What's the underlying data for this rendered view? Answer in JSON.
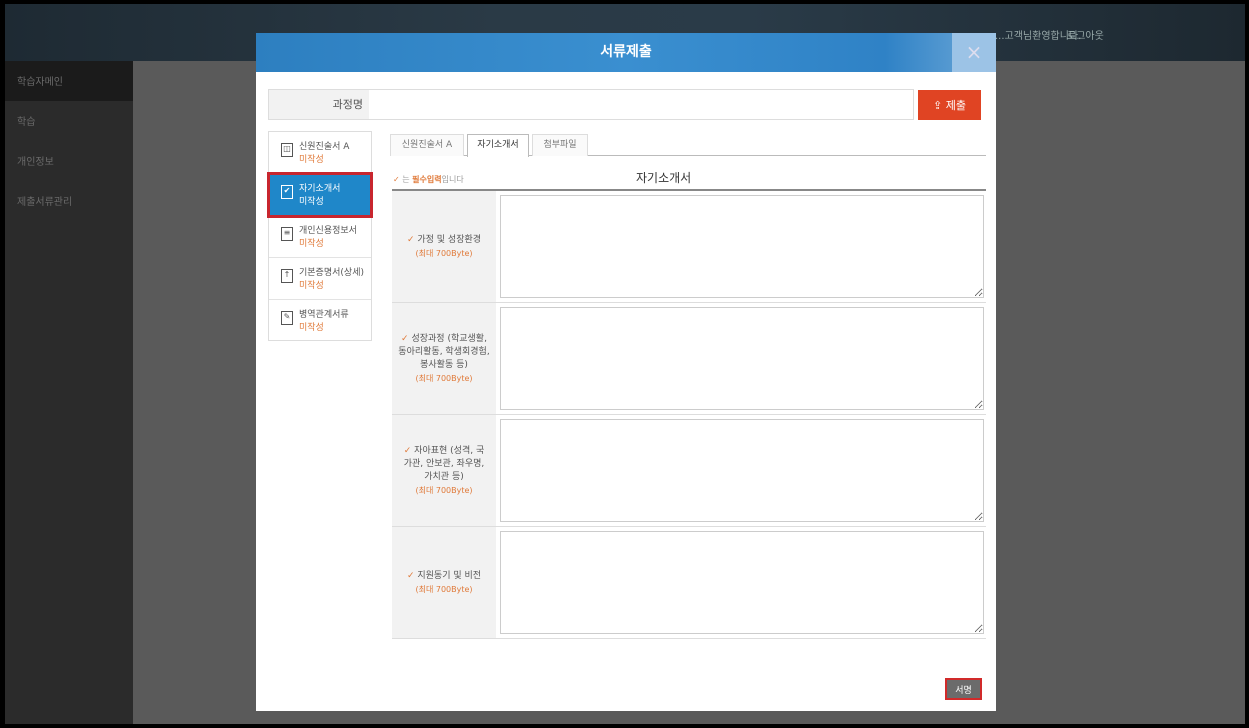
{
  "topbar": {
    "user_text": "...고객님환영합니다.",
    "logout_label": "로그아웃"
  },
  "leftnav": {
    "items": [
      {
        "label": "학습자메인"
      },
      {
        "label": "학습"
      },
      {
        "label": "개인정보"
      },
      {
        "label": "제출서류관리"
      }
    ]
  },
  "modal": {
    "title": "서류제출",
    "close_label": "×",
    "course_label": "과정명",
    "course_value": "",
    "submit_label": "⇪ 제출",
    "sign_label": "서명"
  },
  "documents": [
    {
      "name": "신원진술서 A",
      "status": "미작성",
      "icon": "document-icon",
      "glyph": "◫"
    },
    {
      "name": "자기소개서",
      "status": "미작성",
      "icon": "checkbox-icon",
      "glyph": "✔"
    },
    {
      "name": "개인신용정보서",
      "status": "미작성",
      "icon": "list-icon",
      "glyph": "≡"
    },
    {
      "name": "기본증명서(상세)",
      "status": "미작성",
      "icon": "upload-icon",
      "glyph": "↑"
    },
    {
      "name": "병역관계서류",
      "status": "미작성",
      "icon": "edit-icon",
      "glyph": "✎"
    }
  ],
  "tabs": [
    {
      "label": "신원진술서 A"
    },
    {
      "label": "자기소개서"
    },
    {
      "label": "첨부파일"
    }
  ],
  "required_note": {
    "mark": "✓",
    "prefix": " 는 ",
    "strong": "필수입력",
    "suffix": "입니다"
  },
  "section_title": "자기소개서",
  "form_rows": [
    {
      "check": "✓",
      "label": "가정 및 성장환경",
      "limit": "(최대 700Byte)"
    },
    {
      "check": "✓",
      "label": "성장과정 (학교생활, 동아리활동, 학생회경험, 봉사활동 등)",
      "limit": "(최대 700Byte)"
    },
    {
      "check": "✓",
      "label": "자아표현 (성격, 국가관, 안보관, 좌우명, 가치관 등)",
      "limit": "(최대 700Byte)"
    },
    {
      "check": "✓",
      "label": "지원동기 및 비전",
      "limit": "(최대 700Byte)"
    }
  ],
  "colors": {
    "accent": "#1f87c9",
    "danger": "#e04423",
    "required": "#e07a3a"
  }
}
